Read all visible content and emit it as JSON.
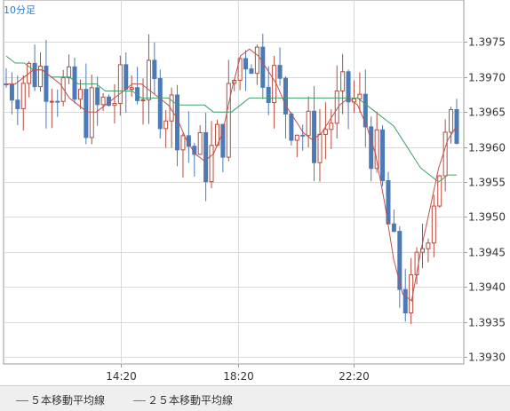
{
  "chart": {
    "timeframe": "10分足"
  },
  "legend": {
    "ma5_label": "５本移動平均線",
    "ma25_label": "２５本移動平均線"
  },
  "colors": {
    "up": "#b84a3a",
    "down": "#4a7ab8",
    "ma5": "#c0504d",
    "ma25": "#3ca06a",
    "grid": "#d9d9d9",
    "axis": "#999999"
  },
  "chart_data": {
    "type": "candlestick",
    "ylim": [
      1.3929,
      1.3981
    ],
    "y_ticks": [
      "1.3930",
      "1.3935",
      "1.3940",
      "1.3945",
      "1.3950",
      "1.3955",
      "1.3960",
      "1.3965",
      "1.3970",
      "1.3975"
    ],
    "x_ticks": [
      "14:20",
      "18:20",
      "22:20"
    ],
    "grid": true,
    "ma5": [
      1.3969,
      1.3969,
      1.397,
      1.3971,
      1.3971,
      1.397,
      1.3969,
      1.3967,
      1.3966,
      1.3965,
      1.3965,
      1.3966,
      1.3967,
      1.3968,
      1.3969,
      1.3969,
      1.3968,
      1.3967,
      1.3966,
      1.3964,
      1.3961,
      1.3959,
      1.3958,
      1.3959,
      1.3962,
      1.3968,
      1.3973,
      1.3974,
      1.3973,
      1.3971,
      1.3969,
      1.3966,
      1.3964,
      1.3962,
      1.3961,
      1.3962,
      1.3964,
      1.3966,
      1.3967,
      1.3966,
      1.3963,
      1.3959,
      1.3952,
      1.3944,
      1.3939,
      1.3938,
      1.3945,
      1.3951,
      1.3957,
      1.3961,
      1.3963
    ],
    "ma25": [
      1.3973,
      1.3972,
      1.3972,
      1.3971,
      1.3971,
      1.397,
      1.397,
      1.397,
      1.3969,
      1.3969,
      1.3969,
      1.3968,
      1.3968,
      1.3968,
      1.3968,
      1.3967,
      1.3967,
      1.3967,
      1.3967,
      1.3966,
      1.3966,
      1.3966,
      1.3966,
      1.3965,
      1.3965,
      1.3965,
      1.3966,
      1.3967,
      1.3967,
      1.3967,
      1.3967,
      1.3967,
      1.3967,
      1.3967,
      1.3967,
      1.3967,
      1.3967,
      1.3967,
      1.3967,
      1.3967,
      1.3966,
      1.3965,
      1.3964,
      1.3963,
      1.3961,
      1.3959,
      1.3957,
      1.3956,
      1.3955,
      1.3956,
      1.3956
    ]
  }
}
